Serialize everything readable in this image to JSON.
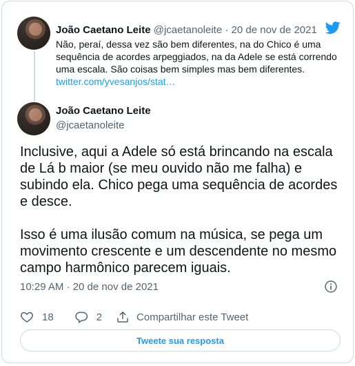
{
  "colors": {
    "accent": "#1d9bf0",
    "text": "#0f1419",
    "muted": "#536471",
    "border": "#cfd9de"
  },
  "quoted": {
    "author_name": "João Caetano Leite",
    "author_handle": "@jcaetanoleite",
    "separator": "·",
    "date": "20 de nov de 2021",
    "text": "Não, peraí, dessa vez são bem diferentes, na do Chico é uma sequência de acordes arpeggiados, na da Adele se está correndo uma escala. São coisas bem simples mas bem diferentes.",
    "link": "twitter.com/yvesanjos/stat…"
  },
  "tweet": {
    "author_name": "João Caetano Leite",
    "author_handle": "@jcaetanoleite",
    "paragraphs": [
      "Inclusive, aqui a Adele só está brincando na escala de Lá b maior (se meu ouvido não me falha) e subindo ela. Chico pega uma sequência de acordes e desce.",
      "Isso é uma ilusão comum na música, se pega um movimento crescente e um descendente no mesmo campo harmônico parecem iguais."
    ],
    "timestamp": "10:29 AM · 20 de nov de 2021"
  },
  "actions": {
    "likes": "18",
    "replies": "2",
    "share_label": "Compartilhar este Tweet"
  },
  "reply_button_label": "Tweete sua resposta",
  "icons": {
    "brand": "twitter-bird-icon",
    "info": "info-icon",
    "like": "heart-icon",
    "reply": "reply-bubble-icon",
    "share": "share-icon"
  }
}
